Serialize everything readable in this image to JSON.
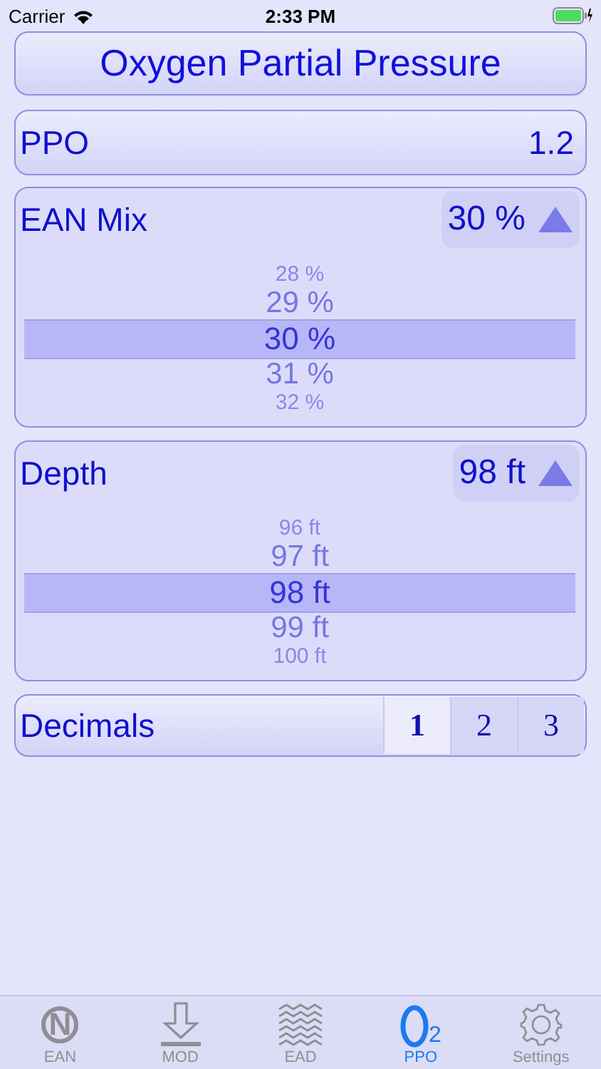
{
  "status_bar": {
    "carrier": "Carrier",
    "time": "2:33 PM"
  },
  "title": "Oxygen Partial Pressure",
  "result": {
    "label": "PPO",
    "value": "1.2"
  },
  "pickers": [
    {
      "label": "EAN Mix",
      "value": "30 %",
      "expanded": true,
      "options": [
        {
          "text": "28 %",
          "selected": false
        },
        {
          "text": "29 %",
          "selected": false
        },
        {
          "text": "30 %",
          "selected": true
        },
        {
          "text": "31 %",
          "selected": false
        },
        {
          "text": "32 %",
          "selected": false
        }
      ]
    },
    {
      "label": "Depth",
      "value": "98 ft",
      "expanded": true,
      "options": [
        {
          "text": "96 ft",
          "selected": false
        },
        {
          "text": "97 ft",
          "selected": false
        },
        {
          "text": "98 ft",
          "selected": true
        },
        {
          "text": "99 ft",
          "selected": false
        },
        {
          "text": "100 ft",
          "selected": false
        }
      ]
    }
  ],
  "decimals": {
    "label": "Decimals",
    "segments": [
      {
        "label": "1",
        "selected": true
      },
      {
        "label": "2",
        "selected": false
      },
      {
        "label": "3",
        "selected": false
      }
    ]
  },
  "tabs": [
    {
      "kind": "nitrox",
      "label": "EAN",
      "icon_text": "N",
      "selected": false
    },
    {
      "kind": "depth",
      "label": "MOD",
      "selected": false
    },
    {
      "kind": "waves",
      "label": "EAD",
      "selected": false
    },
    {
      "kind": "oxygen",
      "label": "PPO",
      "icon_text": "2",
      "selected": true
    },
    {
      "kind": "settings",
      "label": "Settings",
      "selected": false
    }
  ]
}
